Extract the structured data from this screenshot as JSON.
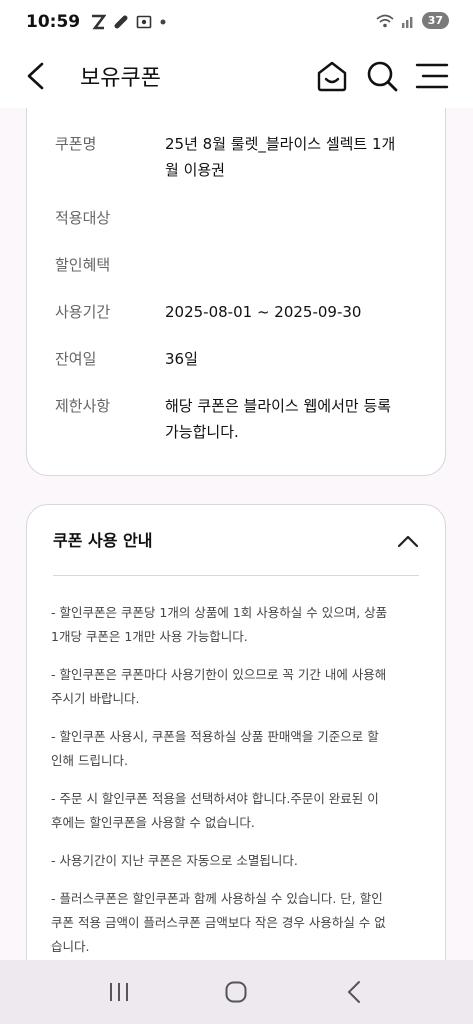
{
  "status_bar": {
    "time": "10:59",
    "battery": "37",
    "icons": [
      "z-app-icon",
      "link-icon",
      "screen-record-icon",
      "dot-icon",
      "wifi-icon",
      "signal-icon"
    ]
  },
  "header": {
    "title": "보유쿠폰"
  },
  "coupon_info": {
    "rows": [
      {
        "label": "쿠폰명",
        "value_line1": "25년 8월 룰렛_블라이스 셀렉트 1개",
        "value_line2": "월 이용권"
      },
      {
        "label": "적용대상",
        "value_line1": "",
        "value_line2": ""
      },
      {
        "label": "할인혜택",
        "value_line1": "",
        "value_line2": ""
      },
      {
        "label": "사용기간",
        "value_line1": "2025-08-01 ~ 2025-09-30",
        "value_line2": ""
      },
      {
        "label": "잔여일",
        "value_line1": "36일",
        "value_line2": ""
      },
      {
        "label": "제한사항",
        "value_line1": "해당 쿠폰은 블라이스 웹에서만 등록",
        "value_line2": "가능합니다."
      }
    ]
  },
  "guide": {
    "title": "쿠폰 사용 안내",
    "items": [
      {
        "line1": "- 할인쿠폰은 쿠폰당 1개의 상품에 1회 사용하실 수 있으며, 상품",
        "line2": "1개당 쿠폰은 1개만 사용 가능합니다."
      },
      {
        "line1": "- 할인쿠폰은 쿠폰마다 사용기한이 있으므로 꼭 기간 내에 사용해",
        "line2": "주시기 바랍니다."
      },
      {
        "line1": "- 할인쿠폰 사용시, 쿠폰을 적용하실 상품 판매액을 기준으로 할",
        "line2": "인해 드립니다."
      },
      {
        "line1": "- 주문 시 할인쿠폰 적용을 선택하셔야 합니다.주문이 완료된 이",
        "line2": "후에는 할인쿠폰을 사용할 수 없습니다."
      },
      {
        "line1": "- 사용기간이 지난 쿠폰은 자동으로 소멸됩니다.",
        "line2": ""
      },
      {
        "line1": "- 플러스쿠폰은 할인쿠폰과 함께 사용하실 수 있습니다. 단, 할인",
        "line2": "쿠폰 적용 금액이 플러스쿠폰 금액보다 작은 경우 사용하실 수 없",
        "line3": "습니다."
      }
    ]
  },
  "colors": {
    "background": "#fbf7fb",
    "card_border": "#d9d5dc",
    "nav_bar": "#ede9ef"
  }
}
